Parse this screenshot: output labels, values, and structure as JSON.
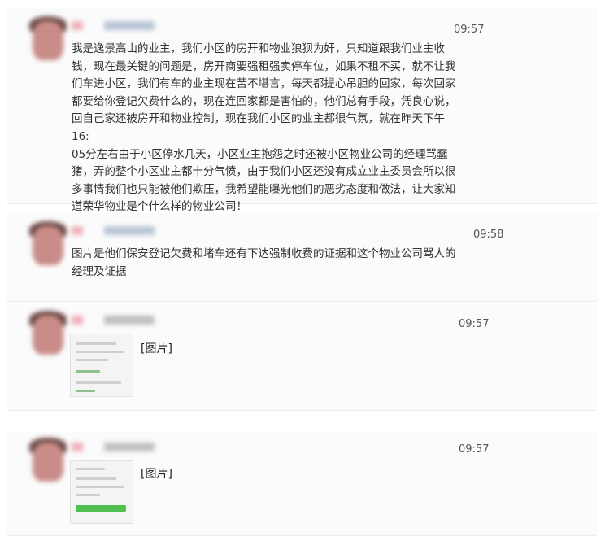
{
  "messages": [
    {
      "time": "09:57",
      "text": "我是逸景高山的业主，我们小区的房开和物业狼狈为奸，只知道跟我们业主收\n钱，现在最关键的问题是，房开商要强租强卖停车位，如果不租不买，就不让我\n们车进小区，我们有车的业主现在苦不堪言，每天都提心吊胆的回家，每次回家\n都要给你登记欠费什么的，现在连回家都是害怕的，他们总有手段，凭良心说，\n回自己家还被房开和物业控制，现在我们小区的业主都很气氛，就在昨天下午16:\n05分左右由于小区停水几天，小区业主抱怨之时还被小区物业公司的经理骂蠢\n猪，弄的整个小区业主都十分气愤，由于我们小区还没有成立业主委员会所以很\n多事情我们也只能被他们欺压，我希望能曝光他们的恶劣态度和做法，让大家知\n道荣华物业是个什么样的物业公司！"
    },
    {
      "time": "09:58",
      "text": "图片是他们保安登记欠费和堵车还有下达强制收费的证据和这个物业公司骂人的\n经理及证据"
    },
    {
      "time": "09:57",
      "image_label": "[图片]"
    },
    {
      "time": "09:57",
      "image_label": "[图片]"
    }
  ],
  "colors": {
    "background": "#ffffff",
    "message_bg": "#fbfbfb",
    "text": "#333333",
    "time": "#555555",
    "thumb_button": "#4fbf4f"
  }
}
